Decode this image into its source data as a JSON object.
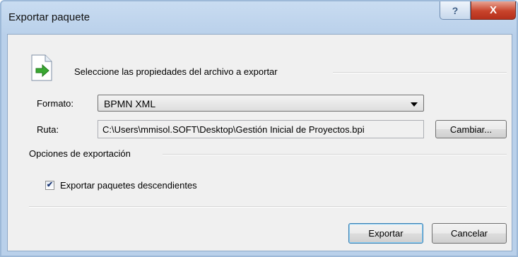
{
  "window": {
    "title": "Exportar paquete",
    "help_glyph": "?",
    "close_glyph": "X"
  },
  "header": {
    "text": "Seleccione las propiedades del archivo a exportar",
    "icon": "export-document-icon"
  },
  "format": {
    "label": "Formato:",
    "value": "BPMN XML"
  },
  "route": {
    "label": "Ruta:",
    "value": "C:\\Users\\mmisol.SOFT\\Desktop\\Gestión Inicial de Proyectos.bpi",
    "change_label": "Cambiar..."
  },
  "options": {
    "section_label": "Opciones de exportación",
    "export_children_label": "Exportar paquetes descendientes",
    "export_children_checked": true
  },
  "actions": {
    "export_label": "Exportar",
    "cancel_label": "Cancelar"
  },
  "colors": {
    "title_bar": "#b9d0ea",
    "close_button": "#c8432b",
    "dialog_background": "#f0f0f0",
    "arrow_green": "#3aa832"
  }
}
